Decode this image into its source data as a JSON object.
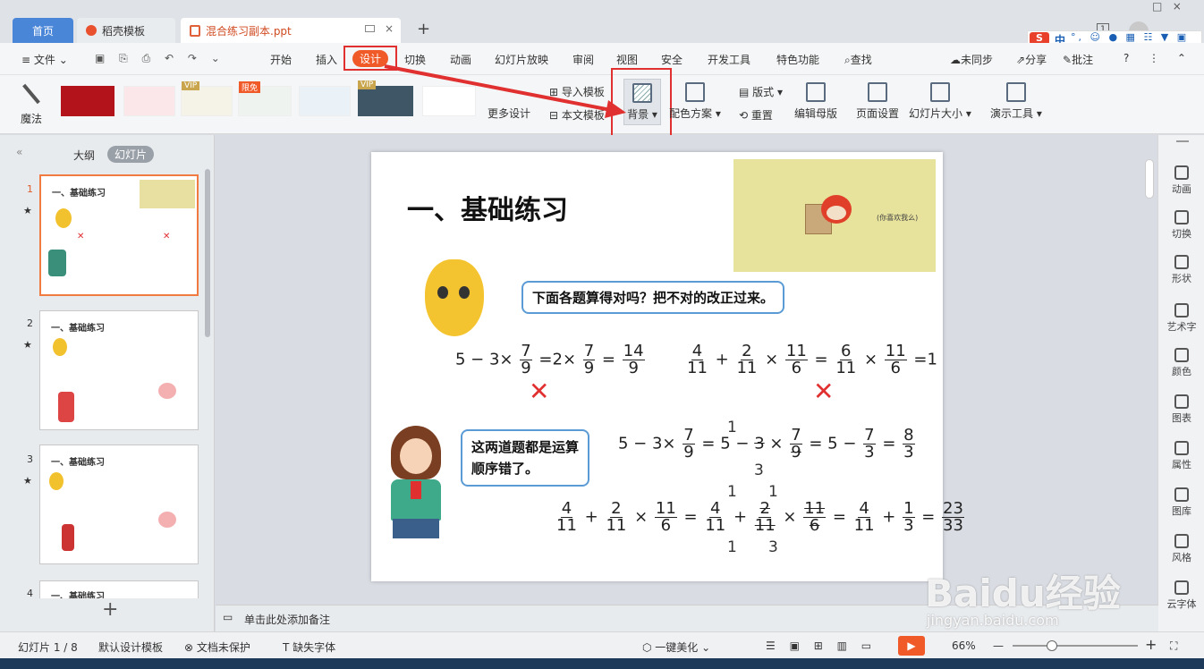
{
  "tabs": {
    "home": "首页",
    "template": "稻壳模板",
    "doc": "混合练习副本.ppt",
    "add": "+"
  },
  "menu": {
    "file": "文件",
    "items": [
      "开始",
      "插入",
      "设计",
      "切换",
      "动画",
      "幻灯片放映",
      "审阅",
      "视图",
      "安全",
      "开发工具",
      "特色功能"
    ],
    "search": "查找",
    "sync": "未同步",
    "share": "分享",
    "comment": "批注",
    "help": "?"
  },
  "ribbon": {
    "magic": "魔法",
    "more_design": "更多设计",
    "import_tpl": "导入模板",
    "this_tpl": "本文模板",
    "background": "背景",
    "color_scheme": "配色方案",
    "layout": "版式",
    "reset": "重置",
    "edit_master": "编辑母版",
    "page_setup": "页面设置",
    "slide_size": "幻灯片大小",
    "presenter": "演示工具",
    "badge_vip": "VIP",
    "badge_free": "限免"
  },
  "ime": {
    "logo": "S",
    "lang": "中"
  },
  "left": {
    "outline": "大纲",
    "slides": "幻灯片",
    "add": "+"
  },
  "thumbs": [
    {
      "num": "1",
      "title": "一、基础练习"
    },
    {
      "num": "2",
      "title": "一、基础练习"
    },
    {
      "num": "3",
      "title": "一、基础练习"
    },
    {
      "num": "4",
      "title": "一、基础练习"
    }
  ],
  "slide": {
    "title": "一、基础练习",
    "bubble1": "下面各题算得对吗？把不对的改正过来。",
    "bubble2a": "这两道题都是运算",
    "bubble2b": "顺序错了。",
    "img_caption": "(你喜欢我么)"
  },
  "right": [
    "动画",
    "切换",
    "形状",
    "艺术字",
    "颜色",
    "图表",
    "属性",
    "图库",
    "风格",
    "云字体"
  ],
  "notes": "单击此处添加备注",
  "status": {
    "slide": "幻灯片 1 / 8",
    "template": "默认设计模板",
    "protect": "文档未保护",
    "font": "缺失字体",
    "beautify": "一键美化",
    "zoom": "66%"
  },
  "watermark": {
    "brand": "Baidu经验",
    "url": "jingyan.baidu.com"
  }
}
